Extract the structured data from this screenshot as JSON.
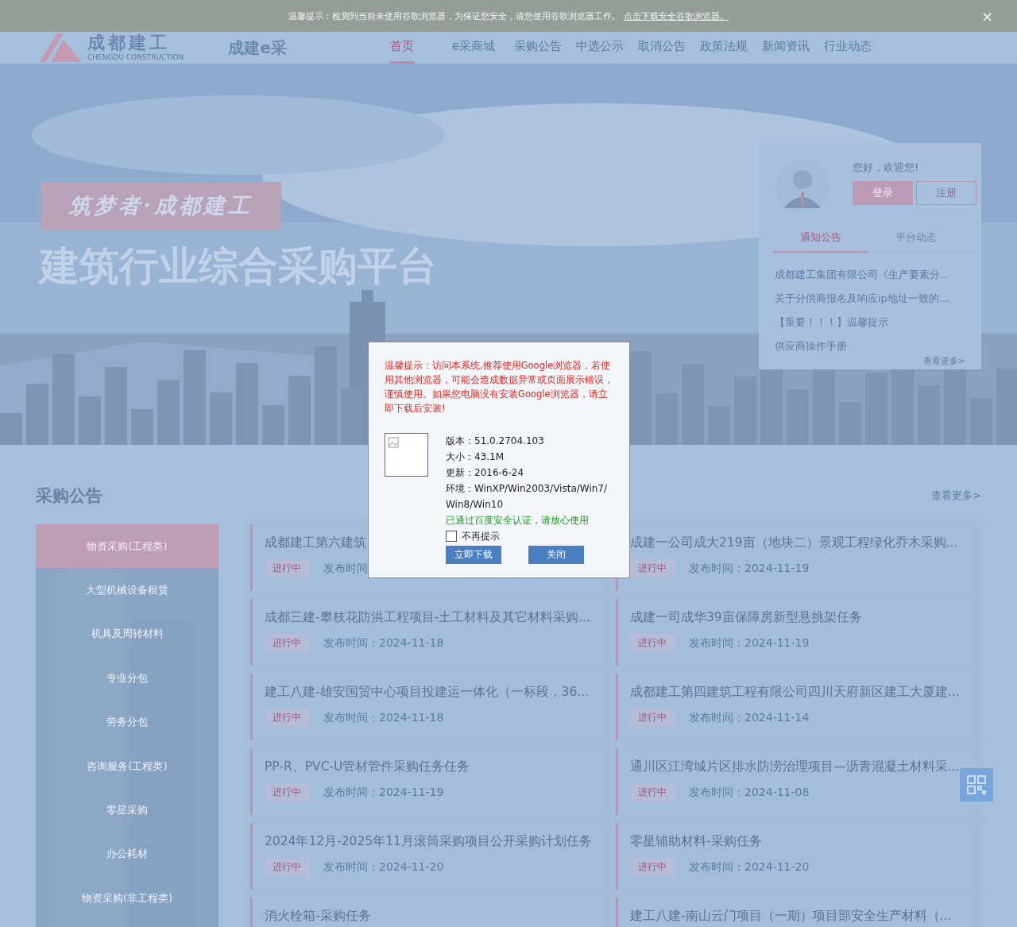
{
  "notice_bar": {
    "text": "温馨提示：检测到当前未使用谷歌浏览器，为保证您安全，请您使用谷歌浏览器工作。",
    "link": "点击下载安全谷歌浏览器。",
    "close": "×"
  },
  "header": {
    "logo_text": "成都建工",
    "logo_subtitle": "CHENGDU CONSTRUCTION",
    "platform_name": "成建e采",
    "nav": [
      {
        "label": "首页",
        "selected": true
      },
      {
        "label": "e采商城",
        "selected": false
      },
      {
        "label": "采购公告",
        "selected": false
      },
      {
        "label": "中选公示",
        "selected": false
      },
      {
        "label": "取消公告",
        "selected": false
      },
      {
        "label": "政策法规",
        "selected": false
      },
      {
        "label": "新闻资讯",
        "selected": false
      },
      {
        "label": "行业动态",
        "selected": false
      }
    ]
  },
  "hero": {
    "slogan": "筑梦者·成都建工",
    "title": "建筑行业综合采购平台"
  },
  "user_panel": {
    "greeting": "您好，欢迎您!",
    "login": "登录",
    "register": "注册",
    "tabs": [
      {
        "label": "通知公告",
        "selected": true
      },
      {
        "label": "平台动态",
        "selected": false
      }
    ],
    "items": [
      "成都建工集团有限公司《生产要素分...",
      "关于分供商报名及响应ip地址一致的...",
      "【重要！！！】温馨提示",
      "供应商操作手册"
    ],
    "more": "查看更多>"
  },
  "procurement": {
    "title": "采购公告",
    "more": "查看更多>",
    "categories": [
      {
        "label": "物资采购(工程类)",
        "selected": true
      },
      {
        "label": "大型机械设备租赁",
        "selected": false
      },
      {
        "label": "机具及周转材料",
        "selected": false
      },
      {
        "label": "专业分包",
        "selected": false
      },
      {
        "label": "劳务分包",
        "selected": false
      },
      {
        "label": "咨询服务(工程类)",
        "selected": false
      },
      {
        "label": "零星采购",
        "selected": false
      },
      {
        "label": "办公耗材",
        "selected": false
      },
      {
        "label": "物资采购(非工程类)",
        "selected": false
      }
    ],
    "cards": [
      {
        "title": "成都建工第六建筑",
        "status": "进行中",
        "date": "发布时间"
      },
      {
        "title": "成建一公司成大219亩（地块二）景观工程绿化乔木采购...",
        "status": "进行中",
        "date": "发布时间：2024-11-19"
      },
      {
        "title": "成都三建-攀枝花防洪工程项目-土工材料及其它材料采购...",
        "status": "进行中",
        "date": "发布时间：2024-11-18"
      },
      {
        "title": "成建一司成华39亩保障房新型悬挑架任务",
        "status": "进行中",
        "date": "发布时间：2024-11-19"
      },
      {
        "title": "建工八建-雄安国贸中心项目投建运一体化（一标段，36...",
        "status": "进行中",
        "date": "发布时间：2024-11-18"
      },
      {
        "title": "成都建工第四建筑工程有限公司四川天府新区建工大厦建...",
        "status": "进行中",
        "date": "发布时间：2024-11-14"
      },
      {
        "title": "PP-R、PVC-U管材管件采购任务任务",
        "status": "进行中",
        "date": "发布时间：2024-11-19"
      },
      {
        "title": "通川区江湾城片区排水防涝治理项目—沥青混凝土材料采...",
        "status": "进行中",
        "date": "发布时间：2024-11-08"
      },
      {
        "title": "2024年12月-2025年11月滚筒采购项目公开采购计划任务",
        "status": "进行中",
        "date": "发布时间：2024-11-20"
      },
      {
        "title": "零星辅助材料-采购任务",
        "status": "进行中",
        "date": "发布时间：2024-11-20"
      },
      {
        "title": "消火栓箱-采购任务"
      },
      {
        "title": "建工八建-南山云门项目（一期）项目部安全生产材料（..."
      }
    ]
  },
  "dialog": {
    "message": "温馨提示：访问本系统,推荐使用Google浏览器，若使用其他浏览器，可能会造成数据异常或页面展示错误，谨慎使用。如果您电脑没有安装Google浏览器，请立即下载后安装!",
    "details": [
      "版本：51.0.2704.103",
      "大小：43.1M",
      "更新：2016-6-24",
      "环境：WinXP/Win2003/Vista/Win7/Win8/Win10"
    ],
    "verified": "已通过百度安全认证，请放心使用",
    "checkbox": {
      "label": "不再提示",
      "checked": false
    },
    "buttons": [
      "立即下载",
      "关闭"
    ]
  }
}
